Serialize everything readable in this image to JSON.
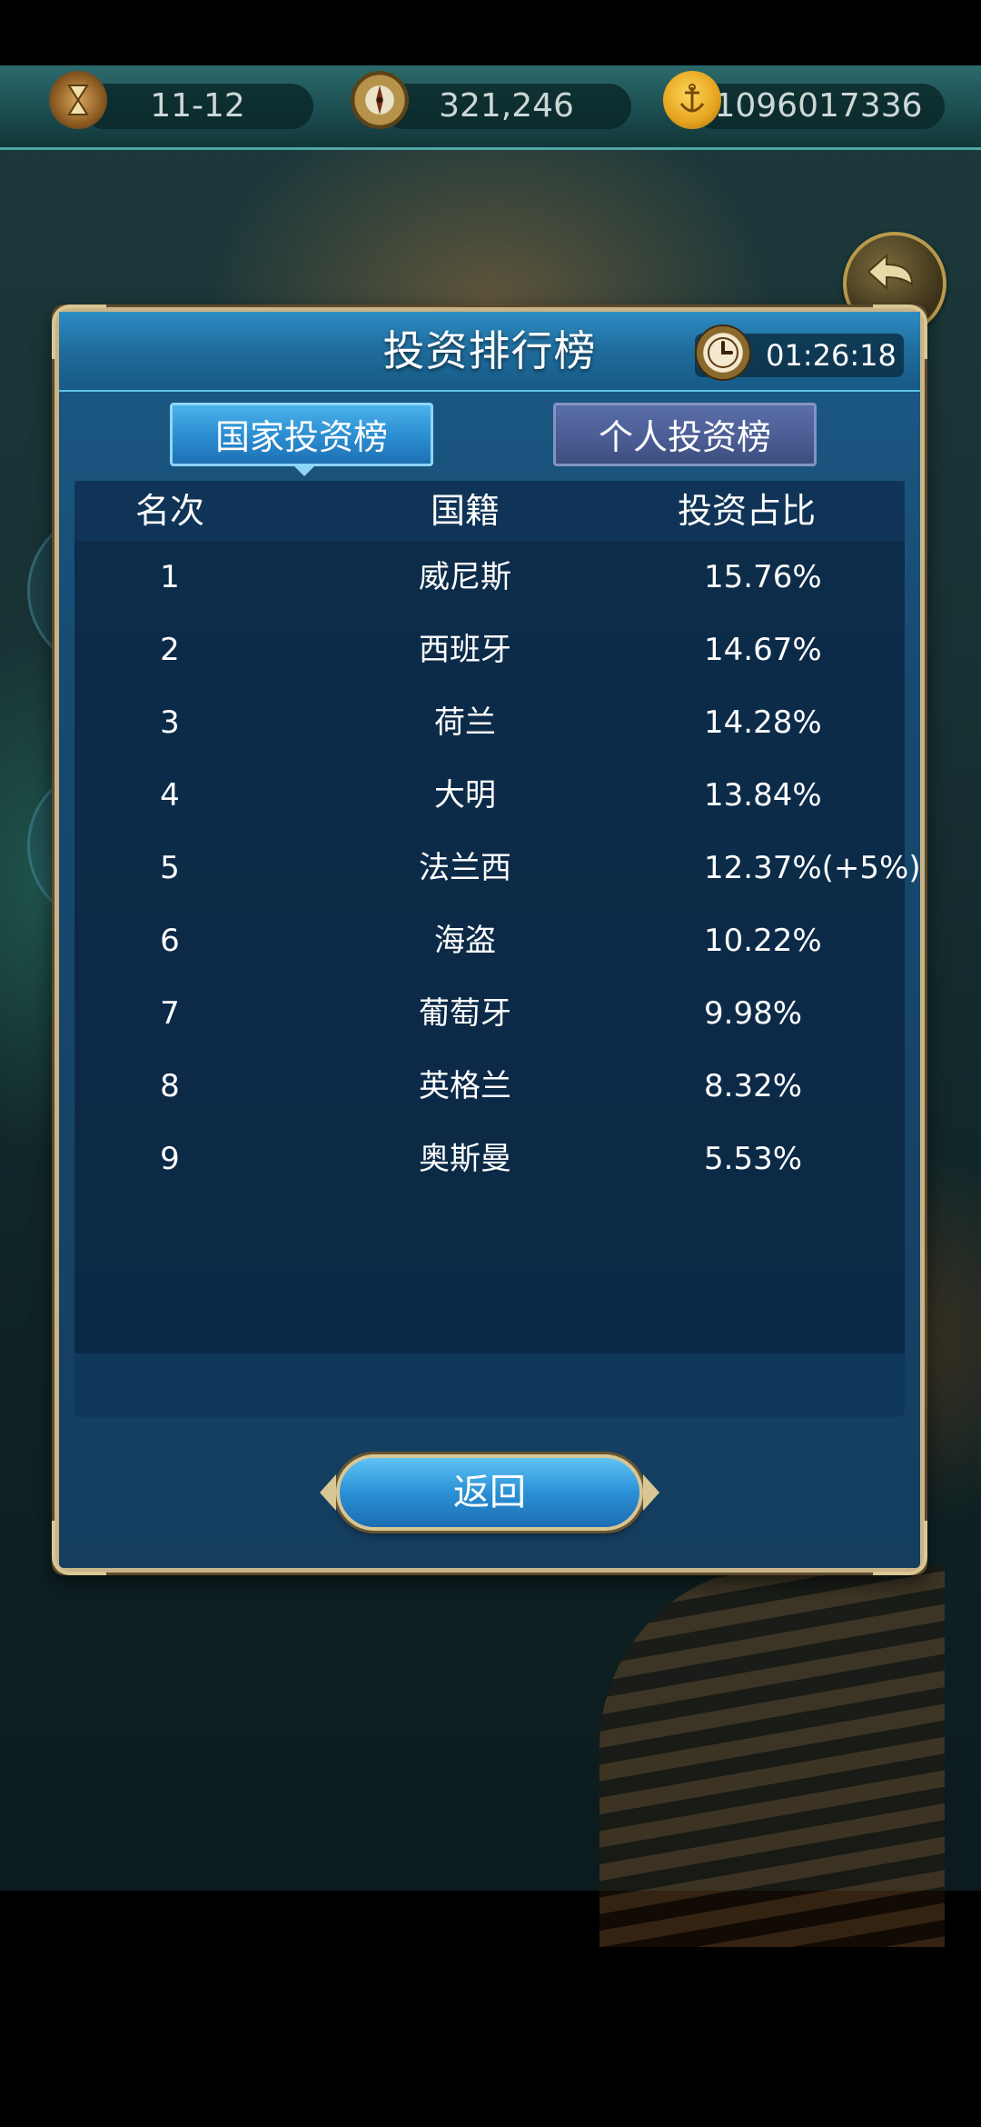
{
  "topbar": {
    "date": "11-12",
    "coins": "321,246",
    "gold": "1096017336"
  },
  "modal": {
    "title": "投资排行榜",
    "timer": "01:26:18",
    "tabs": [
      {
        "label": "国家投资榜",
        "active": true
      },
      {
        "label": "个人投资榜",
        "active": false
      }
    ],
    "table": {
      "headers": {
        "rank": "名次",
        "nation": "国籍",
        "share": "投资占比"
      },
      "rows": [
        {
          "rank": "1",
          "nation": "威尼斯",
          "share": "15.76%"
        },
        {
          "rank": "2",
          "nation": "西班牙",
          "share": "14.67%"
        },
        {
          "rank": "3",
          "nation": "荷兰",
          "share": "14.28%"
        },
        {
          "rank": "4",
          "nation": "大明",
          "share": "13.84%"
        },
        {
          "rank": "5",
          "nation": "法兰西",
          "share": "12.37%(+5%)"
        },
        {
          "rank": "6",
          "nation": "海盗",
          "share": "10.22%"
        },
        {
          "rank": "7",
          "nation": "葡萄牙",
          "share": "9.98%"
        },
        {
          "rank": "8",
          "nation": "英格兰",
          "share": "8.32%"
        },
        {
          "rank": "9",
          "nation": "奥斯曼",
          "share": "5.53%"
        }
      ]
    },
    "return_label": "返回"
  },
  "colors": {
    "modal_border": "#c9b48a",
    "tab_active": "#2a8cd0",
    "tab_inactive": "#4a5c92"
  },
  "icons": [
    "hourglass-icon",
    "compass-icon",
    "gold-anchor-icon",
    "clock-icon",
    "back-arrow-icon"
  ]
}
